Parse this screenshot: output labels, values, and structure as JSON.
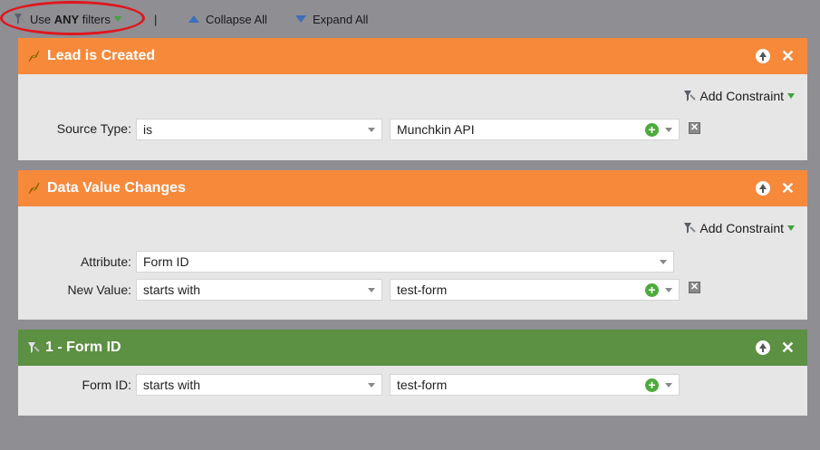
{
  "toolbar": {
    "use_prefix": "Use ",
    "use_strong": "ANY",
    "use_suffix": " filters",
    "separator": "|",
    "collapse_all": "Collapse All",
    "expand_all": "Expand All"
  },
  "panels": [
    {
      "title": "Lead is Created",
      "add_constraint": "Add Constraint",
      "rows": [
        {
          "label": "Source Type:",
          "operator": "is",
          "value": "Munchkin API"
        }
      ]
    },
    {
      "title": "Data Value Changes",
      "add_constraint": "Add Constraint",
      "rows": [
        {
          "label": "Attribute:",
          "operator": "Form ID"
        },
        {
          "label": "New Value:",
          "operator": "starts with",
          "value": "test-form"
        }
      ]
    },
    {
      "title": "1 - Form ID",
      "rows": [
        {
          "label": "Form ID:",
          "operator": "starts with",
          "value": "test-form"
        }
      ]
    }
  ],
  "colors": {
    "orange_header": "#f7893b",
    "green_header": "#5c9042",
    "background": "#8e8e93",
    "panel_body": "#e6e6e6",
    "highlight_oval": "#e0161d"
  },
  "icons": {
    "filter": "funnel-icon",
    "trigger": "lightning-pencil-icon",
    "move_up": "circle-arrow-up-icon",
    "close": "close-icon",
    "add": "plus-circle-icon",
    "delete": "delete-x-icon"
  }
}
